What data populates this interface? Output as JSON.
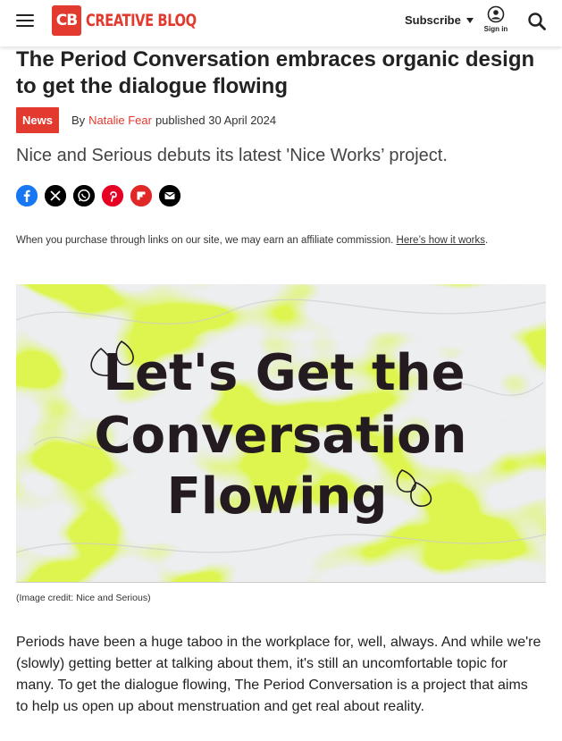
{
  "header": {
    "menu_icon": "hamburger-menu-icon",
    "logo": {
      "badge": "CB",
      "wordmark": "CREATIVE BLOQ",
      "brand_color": "#e23a2e"
    },
    "subscribe_label": "Subscribe",
    "signin_label": "Sign in",
    "search_icon": "search-icon"
  },
  "article": {
    "headline": "The Period Conversation embraces organic design to get the dialogue flowing",
    "category": "News",
    "by": "By",
    "author": "Natalie Fear",
    "published": "published 30 April 2024",
    "standfirst": "Nice and Serious debuts its latest 'Nice Works’ project.",
    "share": [
      {
        "network": "Facebook",
        "icon": "facebook-icon",
        "color": "#1877f2"
      },
      {
        "network": "X",
        "icon": "x-icon",
        "color": "#000000"
      },
      {
        "network": "WhatsApp",
        "icon": "whatsapp-icon",
        "color": "#000000"
      },
      {
        "network": "Pinterest",
        "icon": "pinterest-icon",
        "color": "#e60023"
      },
      {
        "network": "Flipboard",
        "icon": "flipboard-icon",
        "color": "#e12828"
      },
      {
        "network": "Email",
        "icon": "email-icon",
        "color": "#000000"
      }
    ],
    "affiliate_text": "When you purchase through links on our site, we may earn an affiliate commission.",
    "affiliate_link": "Here’s how it works",
    "affiliate_end": ".",
    "hero": {
      "line1": "Let's Get the",
      "line2": "Conversation",
      "line3": "Flowing",
      "accent_color": "#dff550"
    },
    "image_credit": "(Image credit: Nice and Serious)",
    "body": "Periods have been a huge taboo in the workplace for, well, always. And while we're (slowly) getting better at talking about them, it's still an uncomfortable topic for many. To get the dialogue flowing, The Period Conversation is a project that aims to help us open up about menstruation and get real about reality."
  }
}
